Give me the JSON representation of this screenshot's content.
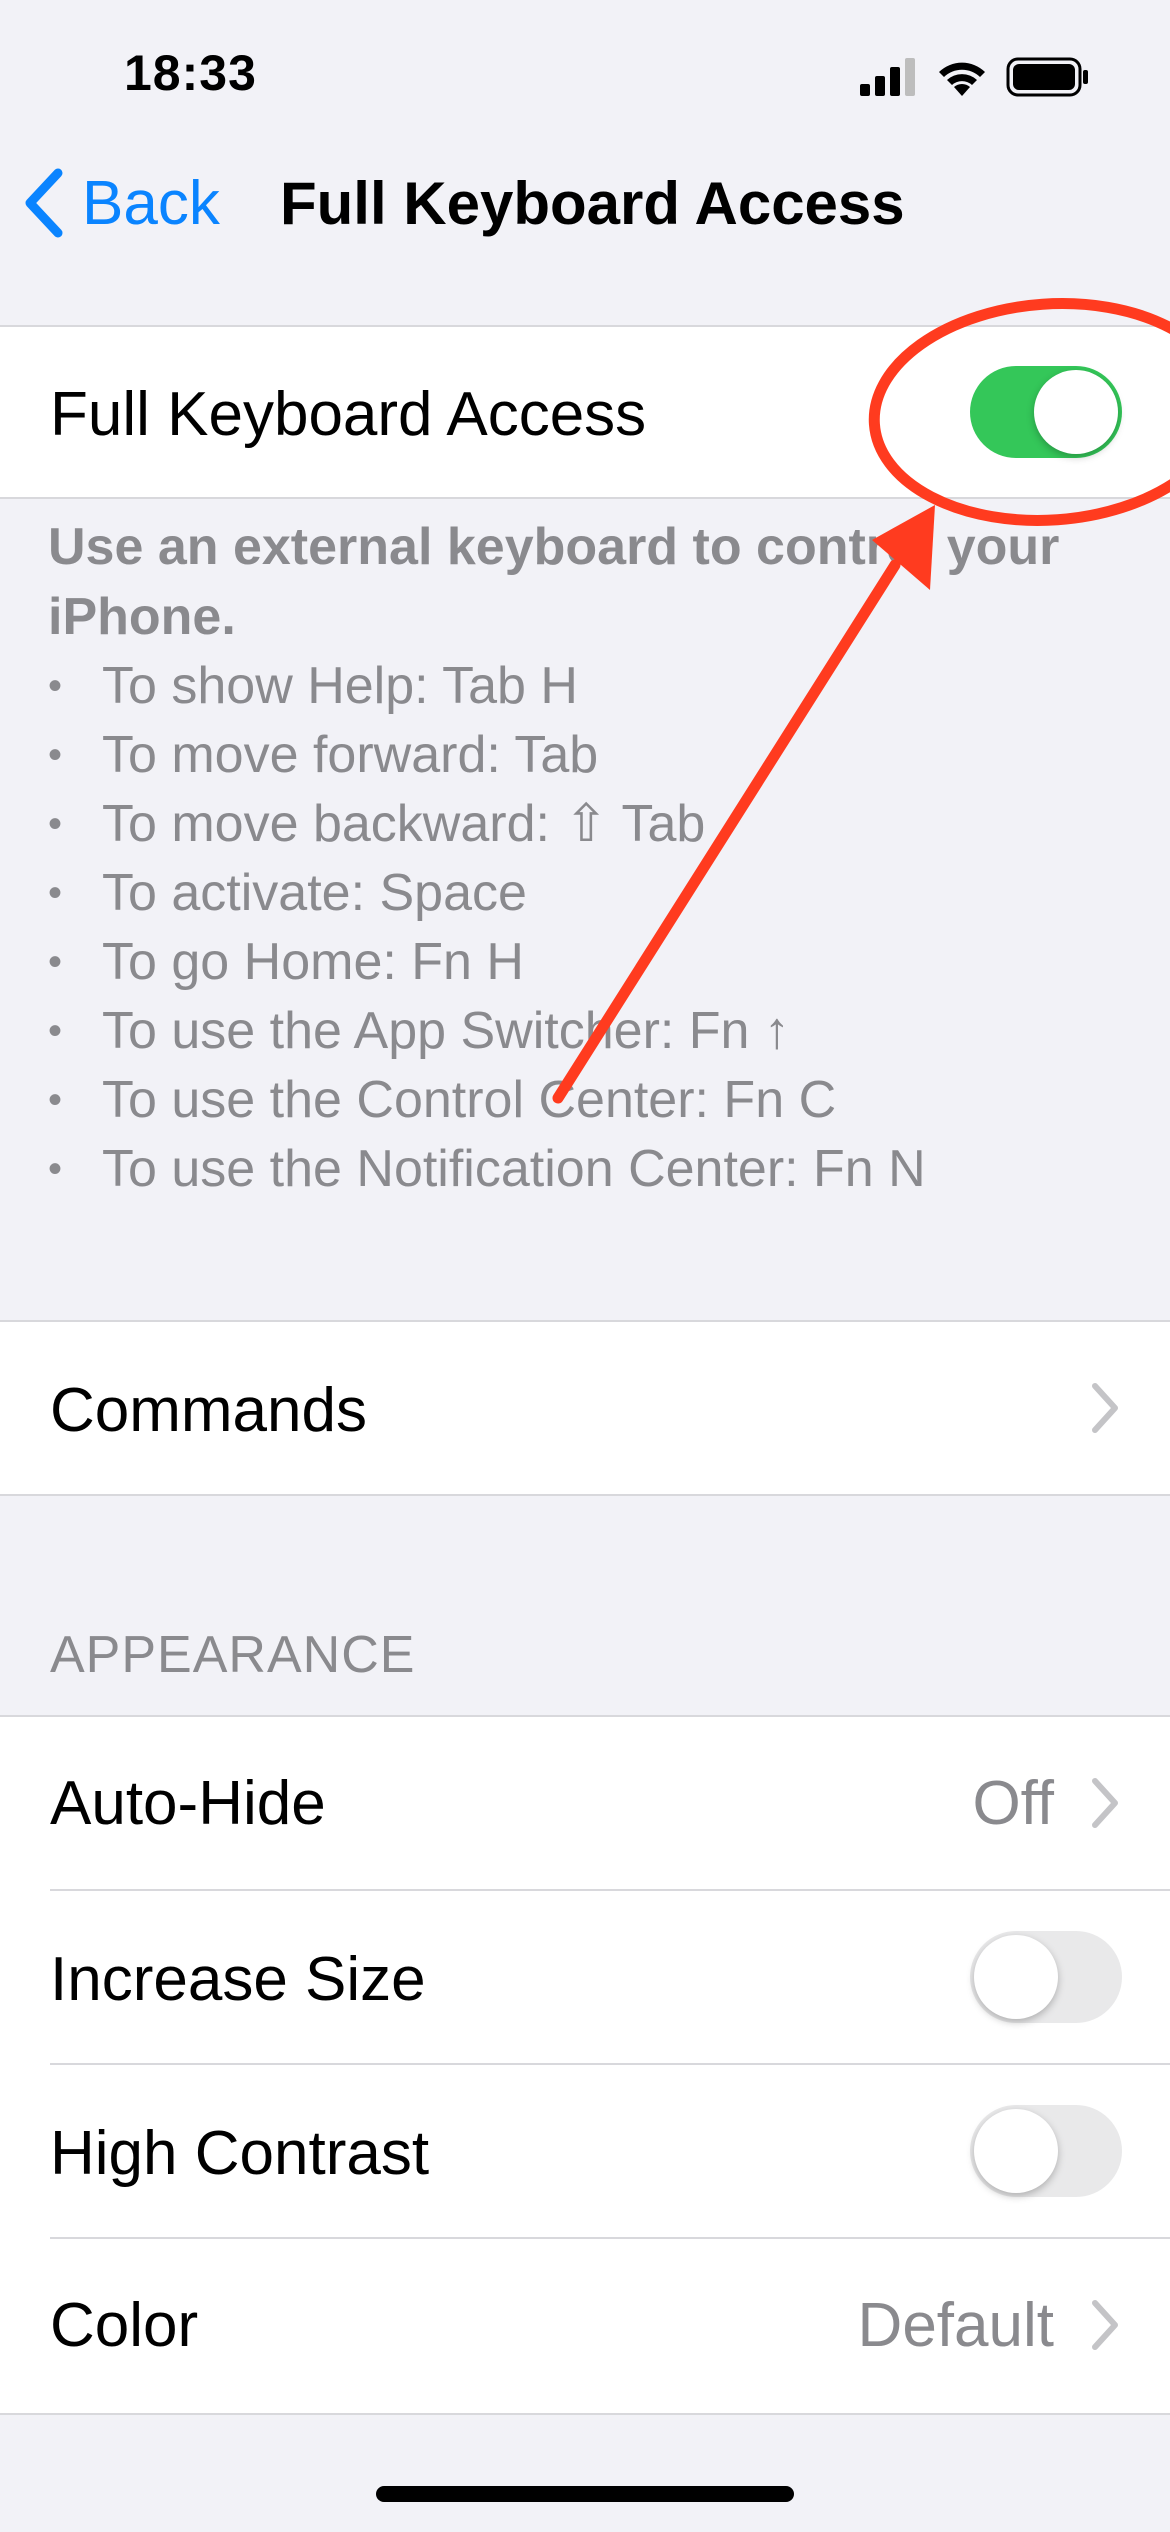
{
  "status_bar": {
    "time": "18:33"
  },
  "nav": {
    "back_label": "Back",
    "title": "Full Keyboard Access"
  },
  "main_toggle": {
    "label": "Full Keyboard Access",
    "state": "on"
  },
  "description": {
    "heading": "Use an external keyboard to control your iPhone.",
    "items": [
      "To show Help: Tab H",
      "To move forward: Tab",
      "To move backward: ⇧ Tab",
      "To activate: Space",
      "To go Home: Fn H",
      "To use the App Switcher: Fn ↑",
      "To use the Control Center: Fn C",
      "To use the Notification Center: Fn N"
    ],
    "bullet": "•"
  },
  "commands": {
    "label": "Commands"
  },
  "appearance": {
    "header": "APPEARANCE",
    "auto_hide": {
      "label": "Auto-Hide",
      "value": "Off"
    },
    "increase_size": {
      "label": "Increase Size",
      "state": "off"
    },
    "high_contrast": {
      "label": "High Contrast",
      "state": "off"
    },
    "color": {
      "label": "Color",
      "value": "Default"
    }
  },
  "colors": {
    "accent": "#0a84ff",
    "toggle_on": "#34c759",
    "annotation": "#ff3b1f"
  },
  "icons": [
    "cellular-signal-icon",
    "wifi-icon",
    "battery-icon",
    "back-chevron-icon",
    "chevron-right-icon"
  ]
}
